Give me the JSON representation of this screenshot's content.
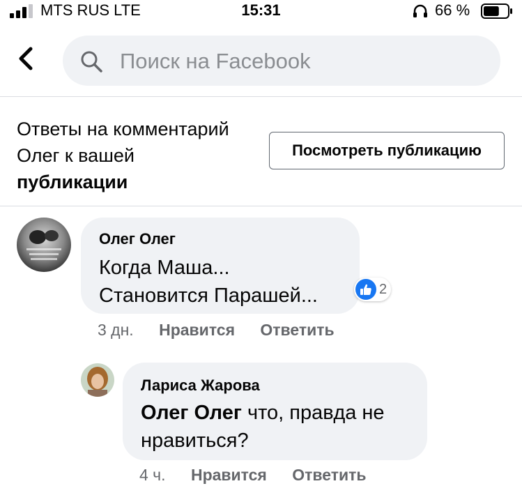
{
  "status_bar": {
    "carrier": "MTS RUS  LTE",
    "time": "15:31",
    "battery_percent": "66 %",
    "battery_level": 0.66
  },
  "search": {
    "placeholder": "Поиск на Facebook"
  },
  "context": {
    "line1": "Ответы на комментарий",
    "line2": "Олег к вашей",
    "line3": "публикации",
    "view_post_button": "Посмотреть публикацию"
  },
  "comments": [
    {
      "author": "Олег Олег",
      "text_line1": "Когда Маша...",
      "text_line2": "Становится Парашей...",
      "reaction_count": "2",
      "time": "3 дн.",
      "like_label": "Нравится",
      "reply_label": "Ответить"
    },
    {
      "author": "Лариса Жарова",
      "mention": "Олег Олег",
      "text_line1": " что, правда не",
      "text_line2": "нравиться?",
      "time": "4 ч.",
      "like_label": "Нравится",
      "reply_label": "Ответить"
    }
  ],
  "colors": {
    "accent": "#1877f2",
    "bubble": "#f0f2f5",
    "secondary_text": "#65676b"
  }
}
